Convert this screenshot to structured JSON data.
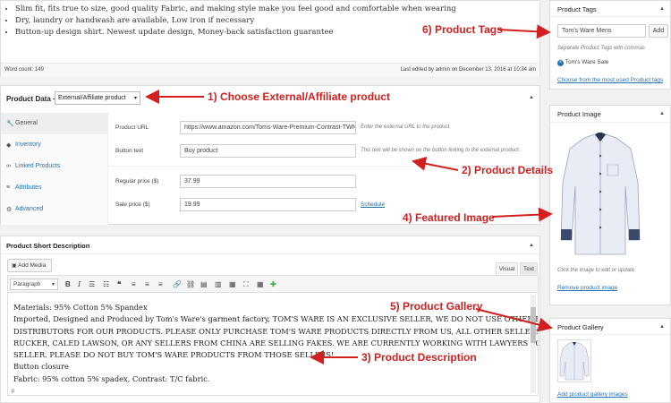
{
  "description_bullets": [
    "Slim fit, fits true to size, good quality Fabric, and making style make you feel good and comfortable when wearing",
    "Dry, laundry or handwash are available, Low iron if necessary",
    "Button-up design shirt. Newest update design, Money-back satisfaction guarantee"
  ],
  "word_count": "Word count: 149",
  "last_edited": "Last edited by admin on December 13, 2016 at 10:34 am",
  "product_data": {
    "label": "Product Data —",
    "type_select": "External/Affiliate product",
    "tabs": [
      {
        "label": "General",
        "icon": "wrench-icon"
      },
      {
        "label": "Inventory",
        "icon": "tag-icon"
      },
      {
        "label": "Linked Products",
        "icon": "link-icon"
      },
      {
        "label": "Attributes",
        "icon": "list-icon"
      },
      {
        "label": "Advanced",
        "icon": "gear-icon"
      }
    ],
    "product_url_label": "Product URL",
    "product_url_value": "https://www.amazon.com/Toms-Ware-Premium-Contrast-TWNM",
    "product_url_desc": "Enter the external URL to the product.",
    "button_text_label": "Button text",
    "button_text_value": "Buy product",
    "button_text_desc": "This text will be shown on the button linking to the external product.",
    "regular_price_label": "Regular price ($)",
    "regular_price_value": "37.99",
    "sale_price_label": "Sale price ($)",
    "sale_price_value": "19.99",
    "schedule_link": "Schedule"
  },
  "short_description": {
    "title": "Product Short Description",
    "add_media": "Add Media",
    "tab_visual": "Visual",
    "tab_text": "Text",
    "format_select": "Paragraph",
    "lines": [
      "Materials: 95% Cotton 5% Spandex",
      "Imported, Designed and Produced by Tom's Ware's garment factory, TOM'S WARE IS AN EXCLUSIVE SELLER, WE DO NOT USE OTHER BROKERS OR",
      "DISTRIBUTORS FOR OUR PRODUCTS. PLEASE ONLY PURCHASE TOM'S WARE PRODUCTS DIRECTLY FROM US, ALL OTHER SELLERS SUCH AS ANNIE",
      "RUCKER, CALED LAWSON, OR ANY SELLERS FROM CHINA ARE SELLING FAKES. WE ARE CURRENTLY WORKING WITH LAWYERS TO SHUT DOWN THOSE",
      "SELLER. PLEASE DO NOT BUY TOM'S WARE PRODUCTS FROM THOSE SELLERS!",
      "Button closure",
      "Fabric: 95% cotton 5% spadex, Contrast: T/C fabric."
    ],
    "path": "p"
  },
  "tags": {
    "title": "Product Tags",
    "input_value": "Tom's Ware Mens",
    "add_button": "Add",
    "hint": "Separate Product Tags with commas",
    "existing_tag": "Tom's Ware Sale",
    "choose_link": "Choose from the most used Product tags"
  },
  "product_image": {
    "title": "Product Image",
    "hint": "Click the image to edit or update",
    "remove_link": "Remove product image"
  },
  "gallery": {
    "title": "Product Gallery",
    "add_link": "Add product gallery images"
  },
  "annotations": {
    "a1": "1) Choose External/Affiliate product",
    "a2": "2) Product Details",
    "a3": "3) Product Description",
    "a4": "4) Featured Image",
    "a5": "5) Product Gallery",
    "a6": "6) Product Tags"
  },
  "colors": {
    "annotation": "#d21f1f",
    "link": "#2271b1",
    "shirt": "#e8ecf5"
  }
}
